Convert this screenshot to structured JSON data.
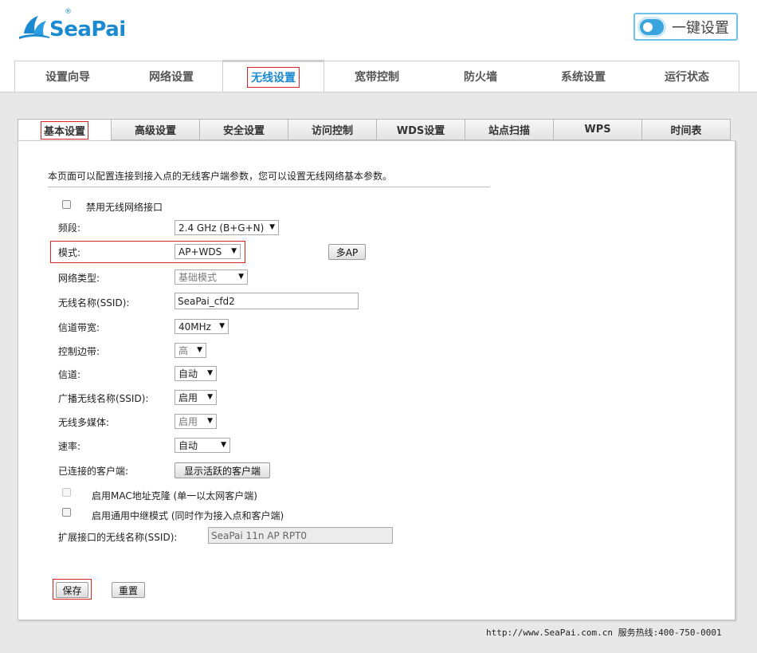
{
  "brand": {
    "name": "SeaPai",
    "registered": "®",
    "onekey_label": "一键设置"
  },
  "main_nav": [
    {
      "label": "设置向导"
    },
    {
      "label": "网络设置"
    },
    {
      "label": "无线设置",
      "active": true
    },
    {
      "label": "宽带控制"
    },
    {
      "label": "防火墙"
    },
    {
      "label": "系统设置"
    },
    {
      "label": "运行状态"
    }
  ],
  "sub_tabs": [
    {
      "label": "基本设置",
      "active": true
    },
    {
      "label": "高级设置"
    },
    {
      "label": "安全设置"
    },
    {
      "label": "访问控制"
    },
    {
      "label": "WDS设置"
    },
    {
      "label": "站点扫描"
    },
    {
      "label": "WPS"
    },
    {
      "label": "时间表"
    }
  ],
  "form": {
    "description": "本页面可以配置连接到接入点的无线客户端参数，您可以设置无线网络基本参数。",
    "disable_wireless": {
      "label": "禁用无线网络接口",
      "checked": false
    },
    "band": {
      "label": "频段:",
      "value": "2.4 GHz (B+G+N)"
    },
    "mode": {
      "label": "模式:",
      "value": "AP+WDS",
      "multi_ap_button": "多AP"
    },
    "network_type": {
      "label": "网络类型:",
      "value": "基础模式"
    },
    "ssid": {
      "label": "无线名称(SSID):",
      "value": "SeaPai_cfd2"
    },
    "channel_width": {
      "label": "信道带宽:",
      "value": "40MHz"
    },
    "control_sideband": {
      "label": "控制边带:",
      "value": "高"
    },
    "channel": {
      "label": "信道:",
      "value": "自动"
    },
    "broadcast_ssid": {
      "label": "广播无线名称(SSID):",
      "value": "启用"
    },
    "wmm": {
      "label": "无线多媒体:",
      "value": "启用"
    },
    "rate": {
      "label": "速率:",
      "value": "自动"
    },
    "connected_clients": {
      "label": "已连接的客户端:",
      "button": "显示活跃的客户端"
    },
    "mac_clone": {
      "label": "启用MAC地址克隆 (单一以太网客户端)",
      "checked": false
    },
    "universal_repeater": {
      "label": "启用通用中继模式 (同时作为接入点和客户端)",
      "checked": false
    },
    "ext_ssid": {
      "label": "扩展接口的无线名称(SSID):",
      "value": "SeaPai 11n AP RPT0"
    },
    "save_button": "保存",
    "reset_button": "重置"
  },
  "footer": {
    "text": "http://www.SeaPai.com.cn 服务热线:400-750-0001"
  },
  "colors": {
    "brand_blue": "#1b8ad1",
    "highlight_red": "#dd2222",
    "page_gray": "#e8e8e8"
  }
}
